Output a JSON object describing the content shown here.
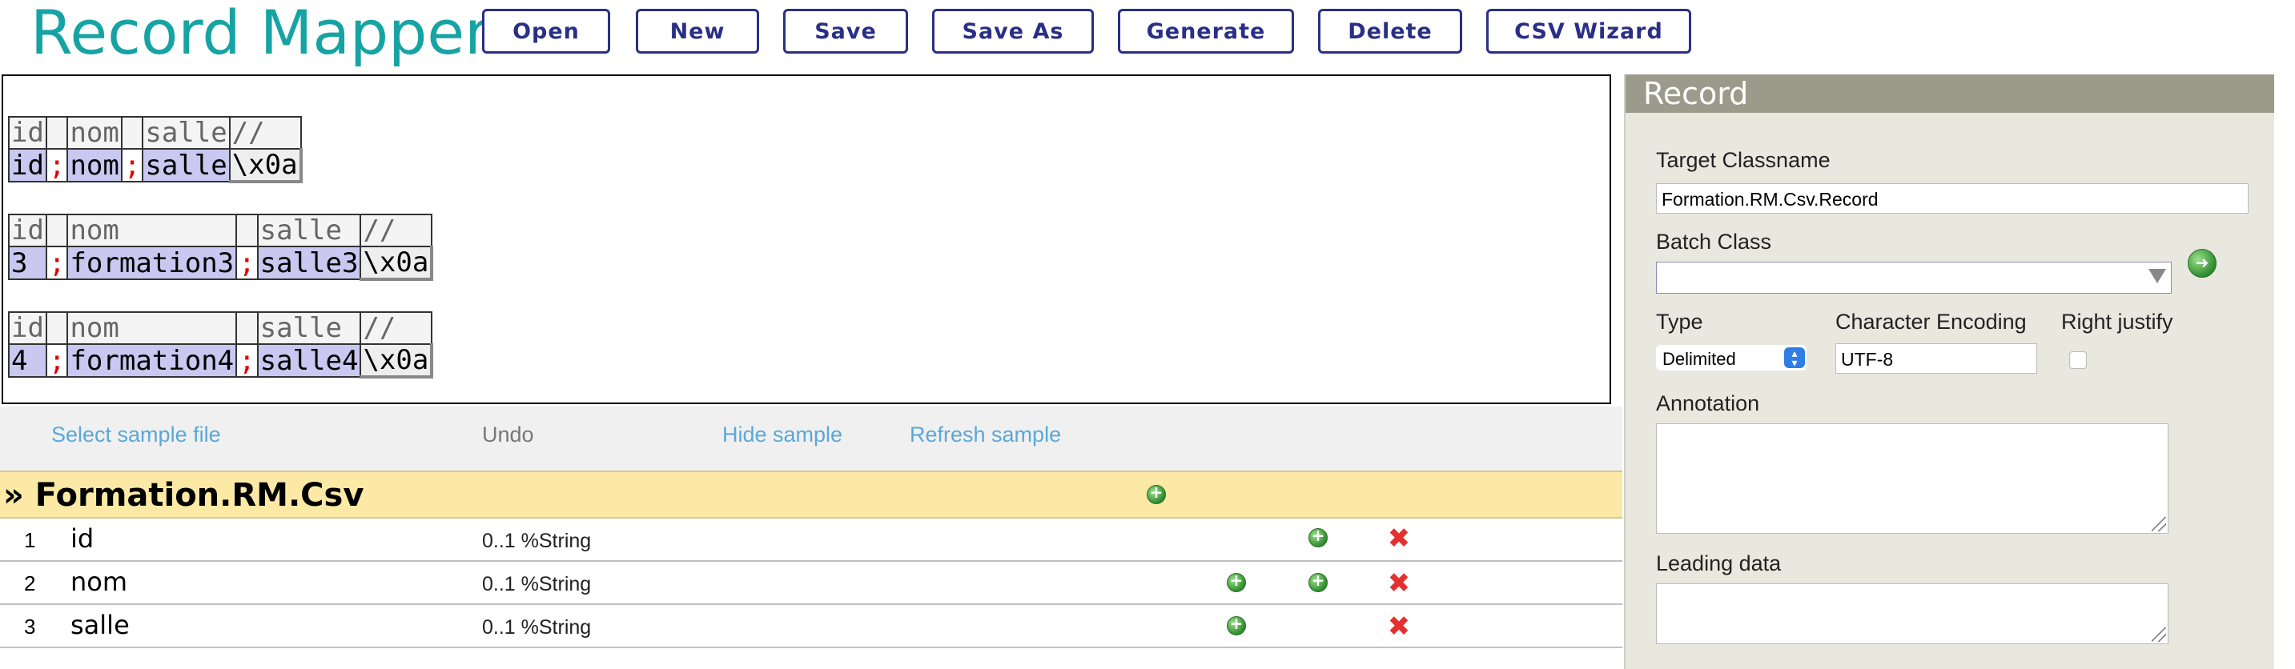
{
  "app": {
    "title": "Record Mapper"
  },
  "toolbar": {
    "buttons": [
      {
        "label": "Open"
      },
      {
        "label": "New"
      },
      {
        "label": "Save"
      },
      {
        "label": "Save As"
      },
      {
        "label": "Generate"
      },
      {
        "label": "Delete"
      },
      {
        "label": "CSV Wizard"
      }
    ]
  },
  "sample": {
    "records": [
      {
        "headers": [
          "id",
          "nom",
          "salle",
          "//"
        ],
        "values": [
          "id",
          ";",
          "nom",
          ";",
          "salle",
          "\\x0a"
        ]
      },
      {
        "headers": [
          "id",
          "nom",
          "salle",
          "//"
        ],
        "values": [
          "3",
          ";",
          "formation3",
          ";",
          "salle3",
          "\\x0a"
        ]
      },
      {
        "headers": [
          "id",
          "nom",
          "salle",
          "//"
        ],
        "values": [
          "4",
          ";",
          "formation4",
          ";",
          "salle4",
          "\\x0a"
        ]
      }
    ]
  },
  "links": {
    "select_sample": "Select sample file",
    "undo": "Undo",
    "hide_sample": "Hide sample",
    "refresh_sample": "Refresh sample"
  },
  "class": {
    "prefix": "»",
    "name": "Formation.RM.Csv",
    "properties": [
      {
        "num": "1",
        "name": "id",
        "type": "0..1 %String"
      },
      {
        "num": "2",
        "name": "nom",
        "type": "0..1 %String"
      },
      {
        "num": "3",
        "name": "salle",
        "type": "0..1 %String"
      }
    ]
  },
  "record": {
    "header": "Record",
    "target_classname_label": "Target Classname",
    "target_classname_value": "Formation.RM.Csv.Record",
    "batch_class_label": "Batch Class",
    "batch_class_value": "",
    "type_label": "Type",
    "type_value": "Delimited",
    "encoding_label": "Character Encoding",
    "encoding_value": "UTF-8",
    "right_justify_label": "Right justify",
    "right_justify_checked": false,
    "annotation_label": "Annotation",
    "leading_data_label": "Leading data"
  },
  "colors": {
    "title": "#17a3a3",
    "toolbar_border": "#2a2f86",
    "field_highlight": "#c8c8f0",
    "separator": "#e00000",
    "class_header_bg": "#fbe9a5",
    "link": "#5aa8d8",
    "record_header_bg": "#9c9a8a"
  },
  "icons": {
    "add": "green-plus-circle-icon",
    "delete": "red-x-icon",
    "go": "green-arrow-circle-icon"
  }
}
